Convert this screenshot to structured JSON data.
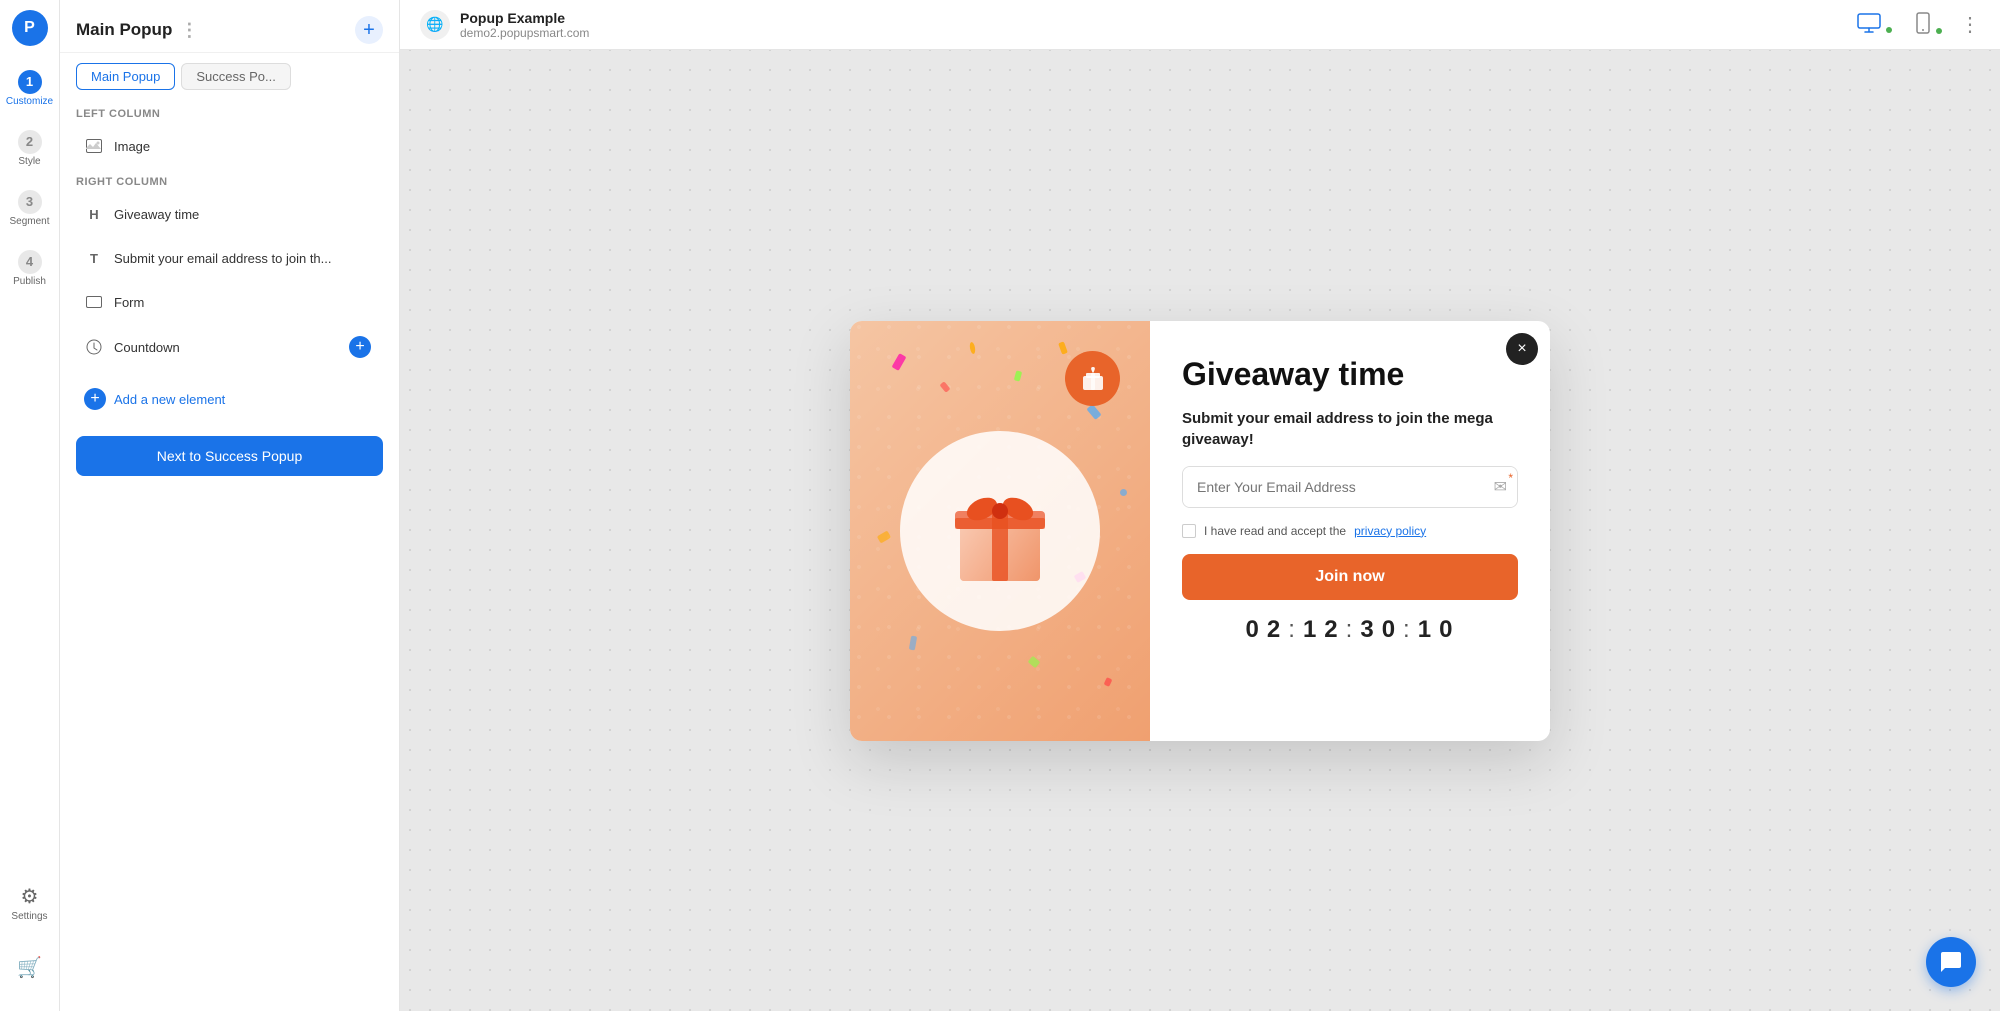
{
  "app": {
    "logo_letter": "P",
    "top_bar": {
      "title": "Popup Example",
      "url": "demo2.popupsmart.com"
    }
  },
  "nav": {
    "items": [
      {
        "id": "customize",
        "step": "1",
        "label": "Customize",
        "active": true
      },
      {
        "id": "style",
        "step": "2",
        "label": "Style",
        "active": false
      },
      {
        "id": "segment",
        "step": "3",
        "label": "Segment",
        "active": false
      },
      {
        "id": "publish",
        "step": "4",
        "label": "Publish",
        "active": false
      }
    ],
    "settings_label": "Settings"
  },
  "panel": {
    "title": "Main Popup",
    "tabs": [
      {
        "id": "main",
        "label": "Main Popup",
        "active": true
      },
      {
        "id": "success",
        "label": "Success Po...",
        "active": false
      }
    ],
    "left_column_label": "LEFT COLUMN",
    "left_column_items": [
      {
        "id": "image",
        "icon": "image",
        "label": "Image"
      }
    ],
    "right_column_label": "RIGHT COLUMN",
    "right_column_items": [
      {
        "id": "heading",
        "icon": "H",
        "label": "Giveaway time"
      },
      {
        "id": "text",
        "icon": "T",
        "label": "Submit your email address to join th..."
      },
      {
        "id": "form",
        "icon": "form",
        "label": "Form"
      },
      {
        "id": "countdown",
        "icon": "clock",
        "label": "Countdown"
      }
    ],
    "add_element_label": "Add a new element",
    "next_btn_label": "Next to Success Popup"
  },
  "popup": {
    "close_label": "×",
    "heading": "Giveaway time",
    "subtext": "Submit your email address to join the mega giveaway!",
    "email_placeholder": "Enter Your Email Address",
    "privacy_text": "I have read and accept the",
    "privacy_link_text": "privacy policy",
    "join_btn_label": "Join now",
    "countdown": {
      "digits": [
        "0",
        "2",
        "1",
        "2",
        "3",
        "0",
        "1",
        "0"
      ],
      "separators": [
        ":",
        ":"
      ]
    }
  },
  "icons": {
    "monitor": "🖥",
    "mobile": "📱",
    "dots": "⋮",
    "image_icon": "🖼",
    "clock_icon": "🕐",
    "form_icon": "▭",
    "envelope_icon": "✉",
    "gift_icon": "🎁",
    "settings_icon": "⚙",
    "chat_icon": "💬",
    "plus_icon": "+"
  }
}
